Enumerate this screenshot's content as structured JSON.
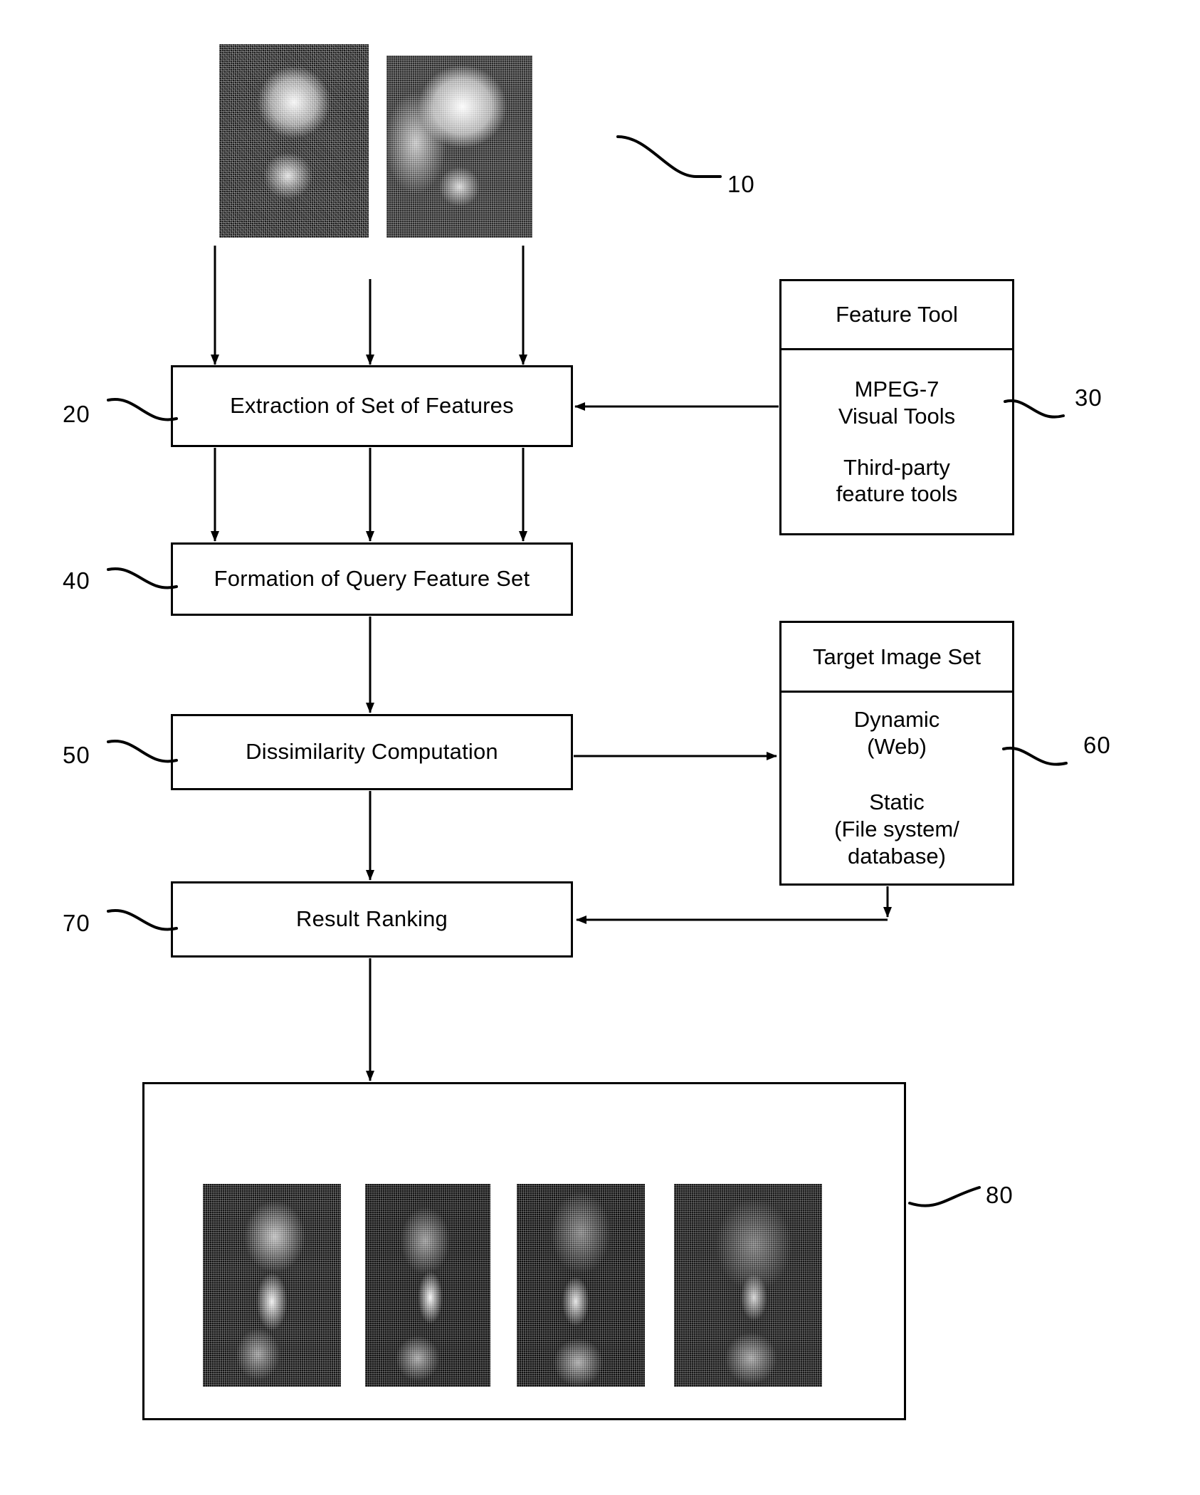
{
  "figure": {
    "type": "patent-flow-diagram",
    "background_color": "#ffffff",
    "line_color": "#000000"
  },
  "query_images": {
    "ref": "10",
    "count": 2,
    "items": [
      {
        "name": "query-portrait-1"
      },
      {
        "name": "query-portrait-2"
      }
    ]
  },
  "process_steps": [
    {
      "ref": "20",
      "label": "Extraction of Set of Features"
    },
    {
      "ref": "40",
      "label": "Formation of Query Feature Set"
    },
    {
      "ref": "50",
      "label": "Dissimilarity Computation"
    },
    {
      "ref": "70",
      "label": "Result Ranking"
    }
  ],
  "feature_tool": {
    "ref": "30",
    "title": "Feature Tool",
    "entries": [
      "MPEG-7\nVisual Tools",
      "Third-party\nfeature tools"
    ],
    "entry_lines": [
      [
        "MPEG-7",
        "Visual Tools"
      ],
      [
        "Third-party",
        "feature tools"
      ]
    ]
  },
  "target_image_set": {
    "ref": "60",
    "title": "Target Image Set",
    "entry_lines": [
      [
        "Dynamic",
        "(Web)"
      ],
      [
        "Static",
        "(File system/",
        "database)"
      ]
    ]
  },
  "result_set": {
    "ref": "80",
    "count": 4,
    "items": [
      {
        "name": "result-portrait-1"
      },
      {
        "name": "result-portrait-2"
      },
      {
        "name": "result-portrait-3"
      },
      {
        "name": "result-portrait-4"
      }
    ]
  },
  "reference_numerals": [
    "10",
    "20",
    "30",
    "40",
    "50",
    "60",
    "70",
    "80"
  ]
}
